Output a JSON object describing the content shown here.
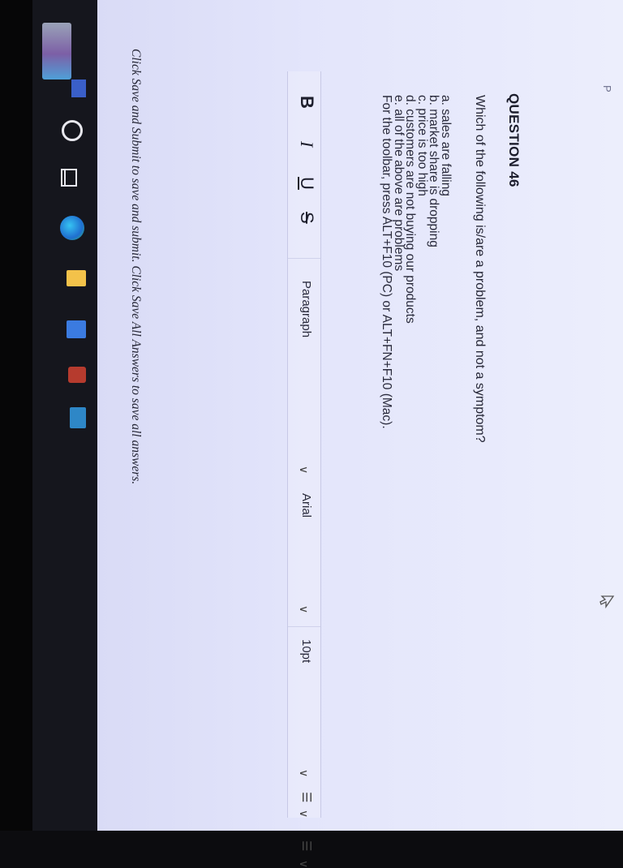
{
  "page": {
    "tab_label": "P"
  },
  "question": {
    "title": "QUESTION 46",
    "prompt": "Which of the following is/are a problem, and not a symptom?",
    "options": [
      "a. sales are falling",
      "b. market share is dropping",
      "c. price is too high",
      "d. customers are not buying our products",
      "e. all of the above are problems"
    ],
    "toolbar_hint": "For the toolbar, press ALT+F10 (PC) or ALT+FN+F10 (Mac)."
  },
  "editor_toolbar": {
    "bold": "B",
    "italic": "I",
    "underline": "U",
    "strikethrough": "S",
    "paragraph_select": "Paragraph",
    "font_select": "Arial",
    "size_select": "10pt",
    "chevron": "∨",
    "list_glyph": "☰"
  },
  "footer": {
    "note": "Click Save and Submit to save and submit. Click Save All Answers to save all answers."
  },
  "taskbar": {
    "icons": [
      "start-icon",
      "search-icon",
      "task-view-icon",
      "edge-browser-icon",
      "file-explorer-icon",
      "store-icon",
      "app-icon",
      "app-icon"
    ]
  }
}
